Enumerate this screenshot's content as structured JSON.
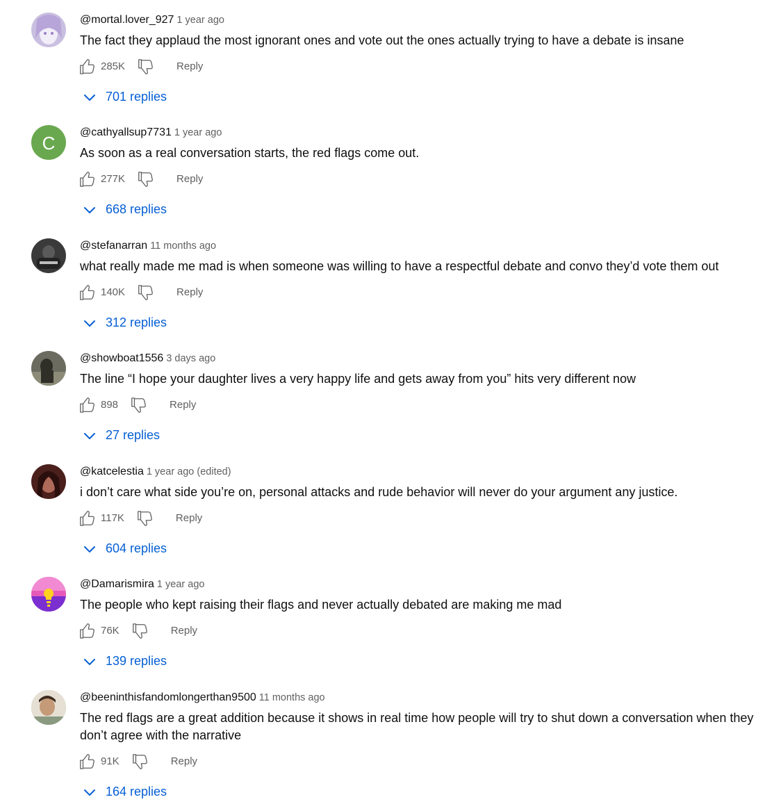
{
  "reply_label": "Reply",
  "colors": {
    "link": "#065fd4",
    "muted": "#606060",
    "text": "#0f0f0f"
  },
  "icons": {
    "like": "thumbs-up-icon",
    "dislike": "thumbs-down-icon",
    "expand": "chevron-down-icon"
  },
  "comments": [
    {
      "author": "@mortal.lover_927",
      "time": "1 year ago",
      "text": "The fact they applaud the most ignorant ones and vote out the ones actually trying to have a debate is insane",
      "likes": "285K",
      "replies": "701 replies",
      "avatar": {
        "kind": "image",
        "bg": "#c9bfe0",
        "fg": "#f2eef8"
      }
    },
    {
      "author": "@cathyallsup7731",
      "time": "1 year ago",
      "text": "As soon as a real conversation starts, the red flags come out.",
      "likes": "277K",
      "replies": "668 replies",
      "avatar": {
        "kind": "letter",
        "letter": "C",
        "bg": "#6aa84f"
      }
    },
    {
      "author": "@stefanarran",
      "time": "11 months ago",
      "text": "what really made me mad is when someone was willing to have a respectful debate and convo they’d vote them out",
      "likes": "140K",
      "replies": "312 replies",
      "avatar": {
        "kind": "image",
        "bg": "#3a3a3a",
        "fg": "#bdbdbd"
      }
    },
    {
      "author": "@showboat1556",
      "time": "3 days ago",
      "text": "The line “I hope your daughter lives a very happy life and gets away from you” hits very different now",
      "likes": "898",
      "replies": "27 replies",
      "avatar": {
        "kind": "image",
        "bg": "#6b6b60",
        "fg": "#2f2f28"
      }
    },
    {
      "author": "@katcelestia",
      "time": "1 year ago (edited)",
      "text": "i don’t care what side you’re on, personal attacks and rude behavior will never do your argument any justice.",
      "likes": "117K",
      "replies": "604 replies",
      "avatar": {
        "kind": "image",
        "bg": "#4a1f1c",
        "fg": "#b06a5a"
      }
    },
    {
      "author": "@Damarismira",
      "time": "1 year ago",
      "text": "The people who kept raising their flags and never actually debated are making me mad",
      "likes": "76K",
      "replies": "139 replies",
      "avatar": {
        "kind": "image",
        "bg": "#e55ab8",
        "fg": "#ffd21f"
      }
    },
    {
      "author": "@beeninthisfandomlongerthan9500",
      "time": "11 months ago",
      "text": "The red flags are a great addition because it shows in real time how people will try to shut down a conversation when they don’t agree with the narrative",
      "likes": "91K",
      "replies": "164 replies",
      "avatar": {
        "kind": "image",
        "bg": "#8a9a80",
        "fg": "#e6e0d4"
      }
    }
  ]
}
